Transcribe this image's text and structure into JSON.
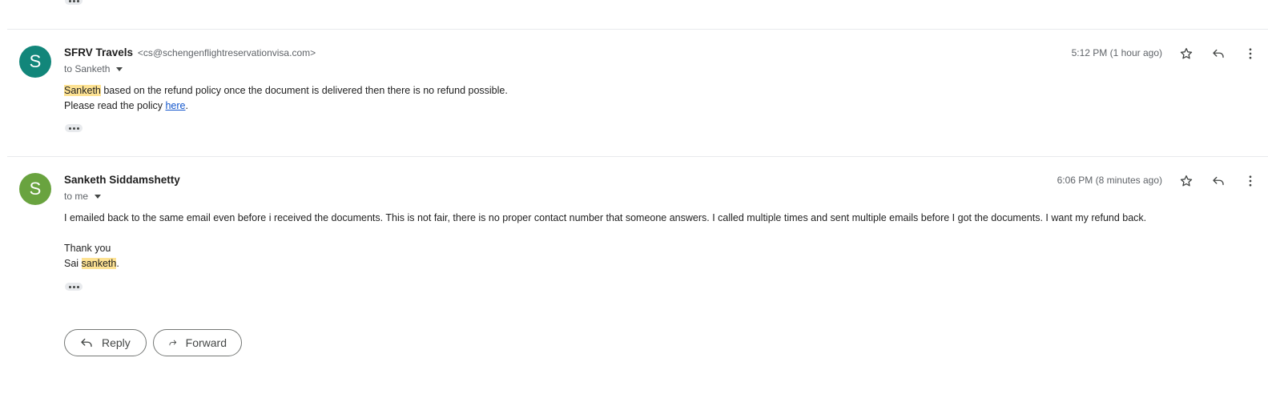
{
  "messages": [
    {
      "avatar_letter": "S",
      "avatar_color": "#12867a",
      "sender_name": "SFRV Travels",
      "sender_email": "<cs@schengenflightreservationvisa.com>",
      "to": "to Sanketh",
      "time": "5:12 PM (1 hour ago)",
      "body_line1_highlight": "Sanketh",
      "body_line1_rest": " based on the refund policy once the document is delivered then there is no refund possible.",
      "body_line2_prefix": "Please read the policy ",
      "body_line2_link": "here",
      "body_line2_suffix": "."
    },
    {
      "avatar_letter": "S",
      "avatar_color": "#69a33f",
      "sender_name": "Sanketh Siddamshetty",
      "to": "to me",
      "time": "6:06 PM (8 minutes ago)",
      "body_line1": "I emailed back to the same email even before i received the documents. This is not fair, there is no proper contact number that someone answers. I called multiple times and sent multiple emails before I got the documents. I want my refund back.",
      "signoff": "Thank you",
      "signature_prefix": "Sai ",
      "signature_highlight": "sanketh",
      "signature_suffix": "."
    }
  ],
  "actions": {
    "reply_label": "Reply",
    "forward_label": "Forward"
  },
  "icons": [
    "more-options-icon",
    "star-icon",
    "reply-arrow-icon",
    "more-vert-icon",
    "forward-arrow-icon"
  ]
}
